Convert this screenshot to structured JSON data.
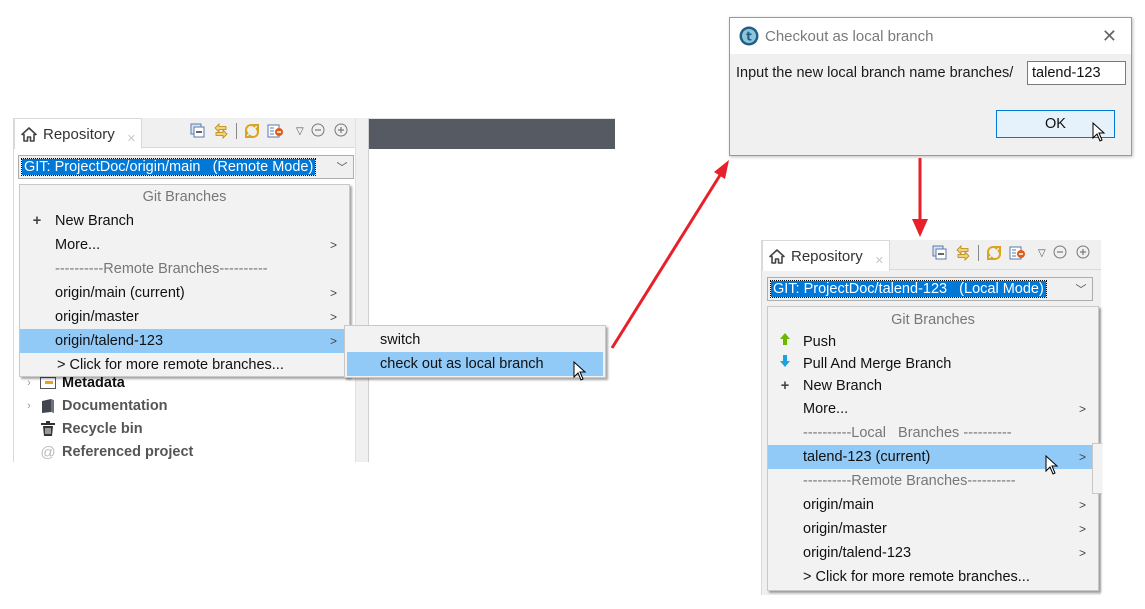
{
  "colors": {
    "selection": "#0078d7",
    "menu_highlight": "#91c9f7",
    "arrow": "#e8202a",
    "push_icon": "#6cb800",
    "pull_icon": "#1ba1e2",
    "dark_bar": "#555a63"
  },
  "left_panel": {
    "tab_label": "Repository",
    "toolbar_icons": [
      "collapse-all-icon",
      "link-with-editor-icon",
      "refresh-icon",
      "filter-icon",
      "view-menu-icon",
      "minimize-icon",
      "maximize-icon"
    ],
    "combo_value": "GIT: ProjectDoc/origin/main   (Remote Mode)",
    "menu": {
      "header": "Git Branches",
      "items": [
        {
          "label": "New Branch",
          "icon": "plus-icon",
          "submenu": false
        },
        {
          "label": "More...",
          "icon": "",
          "submenu": true
        },
        {
          "label": "----------Remote Branches----------",
          "separator": true
        },
        {
          "label": "origin/main (current)",
          "submenu": true
        },
        {
          "label": "origin/master",
          "submenu": true
        },
        {
          "label": "origin/talend-123",
          "submenu": true,
          "highlighted": true
        },
        {
          "label": "> Click for more remote branches...",
          "submenu": false
        }
      ]
    },
    "submenu": {
      "items": [
        {
          "label": "switch"
        },
        {
          "label": "check out as local branch",
          "highlighted": true
        }
      ]
    },
    "tree": [
      {
        "label": "Metadata",
        "icon": "metadata-icon",
        "expandable": true
      },
      {
        "label": "Documentation",
        "icon": "documentation-icon",
        "expandable": true
      },
      {
        "label": "Recycle bin",
        "icon": "recycle-bin-icon",
        "expandable": false
      },
      {
        "label": "Referenced project",
        "icon": "referenced-project-icon",
        "expandable": false
      }
    ]
  },
  "dialog": {
    "title": "Checkout as local branch",
    "prompt": "Input the new local branch name branches/",
    "input_value": "talend-123",
    "ok_label": "OK"
  },
  "right_panel": {
    "tab_label": "Repository",
    "combo_value": "GIT: ProjectDoc/talend-123   (Local Mode)",
    "menu": {
      "header": "Git Branches",
      "items": [
        {
          "label": "Push",
          "icon": "push-icon",
          "submenu": false
        },
        {
          "label": "Pull And Merge Branch",
          "icon": "pull-icon",
          "submenu": false
        },
        {
          "label": "New Branch",
          "icon": "plus-icon",
          "submenu": false
        },
        {
          "label": "More...",
          "icon": "",
          "submenu": true
        },
        {
          "label": "----------Local   Branches ----------",
          "separator": true
        },
        {
          "label": "talend-123 (current)",
          "submenu": true,
          "highlighted": true
        },
        {
          "label": "----------Remote Branches----------",
          "separator": true
        },
        {
          "label": "origin/main",
          "submenu": true
        },
        {
          "label": "origin/master",
          "submenu": true
        },
        {
          "label": "origin/talend-123",
          "submenu": true
        },
        {
          "label": "> Click for more remote branches...",
          "submenu": false
        }
      ]
    }
  }
}
